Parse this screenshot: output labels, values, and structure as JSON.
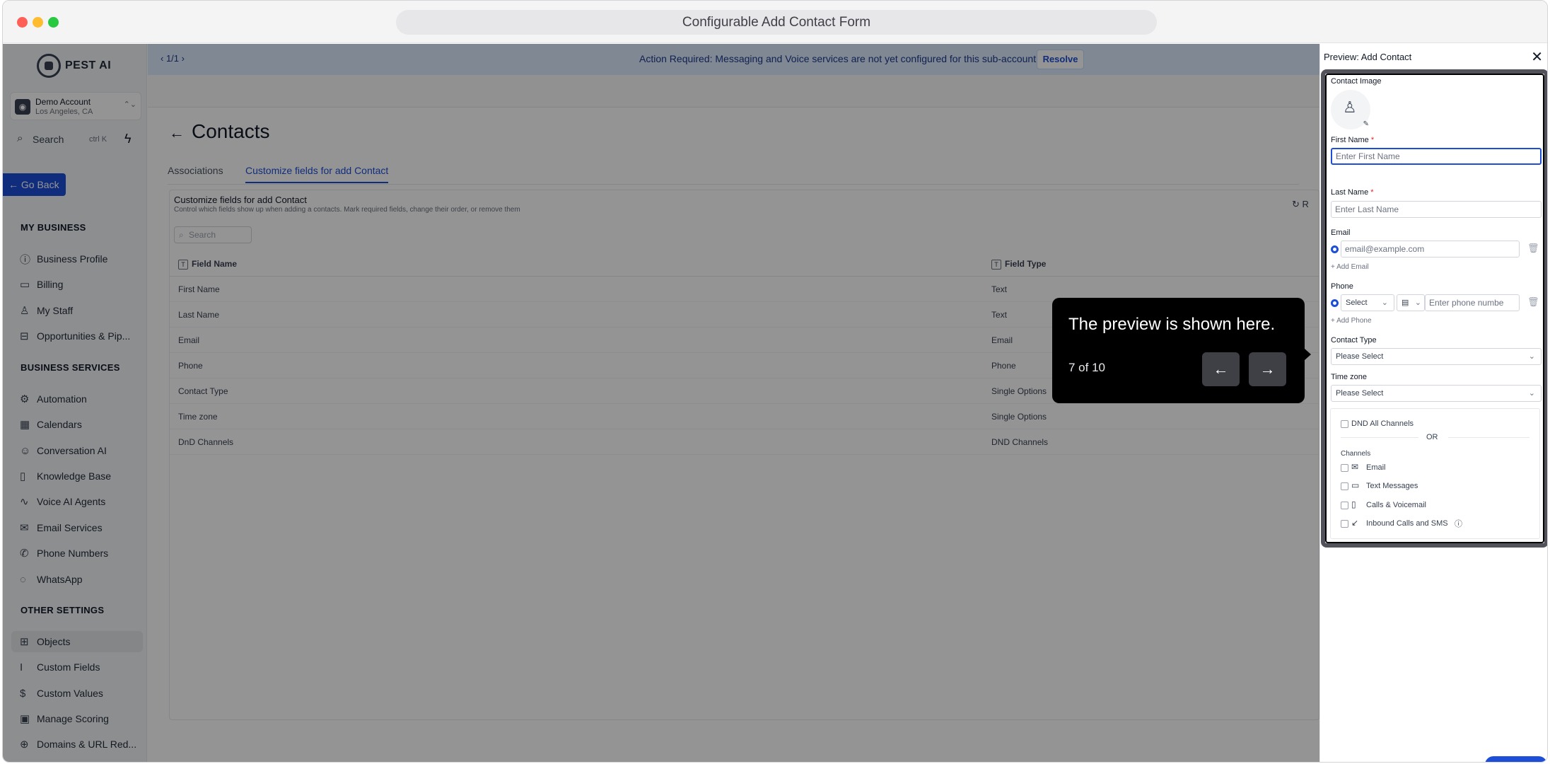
{
  "window": {
    "title": "Configurable Add Contact Form"
  },
  "sidebar": {
    "brand": "PEST AI",
    "account": {
      "name": "Demo Account",
      "location": "Los Angeles, CA"
    },
    "search": {
      "label": "Search",
      "shortcut": "ctrl K"
    },
    "go_back": "Go Back",
    "sections": {
      "my_business": "MY BUSINESS",
      "business_services": "BUSINESS SERVICES",
      "other_settings": "OTHER SETTINGS"
    },
    "my_business_items": [
      {
        "label": "Business Profile",
        "icon": "info-icon"
      },
      {
        "label": "Billing",
        "icon": "card-icon"
      },
      {
        "label": "My Staff",
        "icon": "staff-icon"
      },
      {
        "label": "Opportunities & Pip...",
        "icon": "briefcase-icon"
      }
    ],
    "business_services_items": [
      {
        "label": "Automation",
        "icon": "automation-icon"
      },
      {
        "label": "Calendars",
        "icon": "calendar-icon"
      },
      {
        "label": "Conversation AI",
        "icon": "bot-icon"
      },
      {
        "label": "Knowledge Base",
        "icon": "book-icon"
      },
      {
        "label": "Voice AI Agents",
        "icon": "waveform-icon"
      },
      {
        "label": "Email Services",
        "icon": "mail-icon"
      },
      {
        "label": "Phone Numbers",
        "icon": "phone-icon"
      },
      {
        "label": "WhatsApp",
        "icon": "whatsapp-icon"
      }
    ],
    "other_settings_items": [
      {
        "label": "Objects",
        "icon": "table-icon",
        "active": true
      },
      {
        "label": "Custom Fields",
        "icon": "text-cursor-icon"
      },
      {
        "label": "Custom Values",
        "icon": "dollar-icon"
      },
      {
        "label": "Manage Scoring",
        "icon": "scoring-icon"
      },
      {
        "label": "Domains & URL Red...",
        "icon": "globe-icon"
      }
    ]
  },
  "banner": {
    "pager": "1/1",
    "message": "Action Required: Messaging and Voice services are not yet configured for this sub-account!",
    "resolve": "Resolve"
  },
  "page": {
    "title": "Contacts",
    "tabs": [
      "Associations",
      "Customize fields for add Contact"
    ],
    "card_title": "Customize fields for add Contact",
    "card_desc": "Control which fields show up when adding a contacts. Mark required fields, change their order, or remove them",
    "reset_label": "R",
    "search_placeholder": "Search",
    "columns": [
      "Field Name",
      "Field Type"
    ],
    "rows": [
      {
        "name": "First Name",
        "type": "Text"
      },
      {
        "name": "Last Name",
        "type": "Text"
      },
      {
        "name": "Email",
        "type": "Email"
      },
      {
        "name": "Phone",
        "type": "Phone"
      },
      {
        "name": "Contact Type",
        "type": "Single Options"
      },
      {
        "name": "Time zone",
        "type": "Single Options"
      },
      {
        "name": "DnD Channels",
        "type": "DND Channels"
      }
    ]
  },
  "tooltip": {
    "text": "The preview is shown here.",
    "counter": "7 of 10"
  },
  "preview": {
    "header": "Preview: Add Contact",
    "contact_image": "Contact Image",
    "first_name_label": "First Name",
    "first_name_placeholder": "Enter First Name",
    "last_name_label": "Last Name",
    "last_name_placeholder": "Enter Last Name",
    "required_mark": "*",
    "email_label": "Email",
    "email_placeholder": "email@example.com",
    "add_email": "+ Add Email",
    "phone_label": "Phone",
    "phone_select": "Select",
    "phone_placeholder": "Enter phone numbe",
    "add_phone": "+ Add Phone",
    "contact_type_label": "Contact Type",
    "contact_type_value": "Please Select",
    "timezone_label": "Time zone",
    "timezone_value": "Please Select",
    "dnd_all": "DND All Channels",
    "or": "OR",
    "channels_label": "Channels",
    "channels": [
      "Email",
      "Text Messages",
      "Calls & Voicemail",
      "Inbound Calls and SMS"
    ]
  }
}
